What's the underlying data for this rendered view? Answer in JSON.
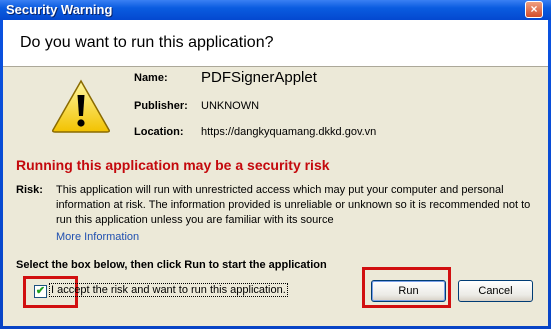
{
  "window": {
    "title": "Security Warning",
    "close_glyph": "×"
  },
  "header": {
    "question": "Do you want to run this application?"
  },
  "details": {
    "name_label": "Name:",
    "name_value": "PDFSignerApplet",
    "publisher_label": "Publisher:",
    "publisher_value": "UNKNOWN",
    "location_label": "Location:",
    "location_value": "https://dangkyquamang.dkkd.gov.vn"
  },
  "risk": {
    "heading": "Running this application may be a security risk",
    "label": "Risk:",
    "text": "This application will run with unrestricted access which may put your computer and personal information at risk. The information provided is unreliable or unknown so it is recommended not to run this application unless you are familiar with its source",
    "more_info": "More Information"
  },
  "accept": {
    "instruction": "Select the box below, then click Run to start the application",
    "checkbox_label": "I accept the risk and want to run this application.",
    "checked": true,
    "check_glyph": "✔"
  },
  "buttons": {
    "run": "Run",
    "cancel": "Cancel"
  },
  "colors": {
    "risk_heading": "#c4090d",
    "highlight": "#d10f10",
    "title_bar": "#0a5ce0"
  },
  "icons": {
    "warning": "warning-triangle-icon",
    "close": "close-icon"
  }
}
